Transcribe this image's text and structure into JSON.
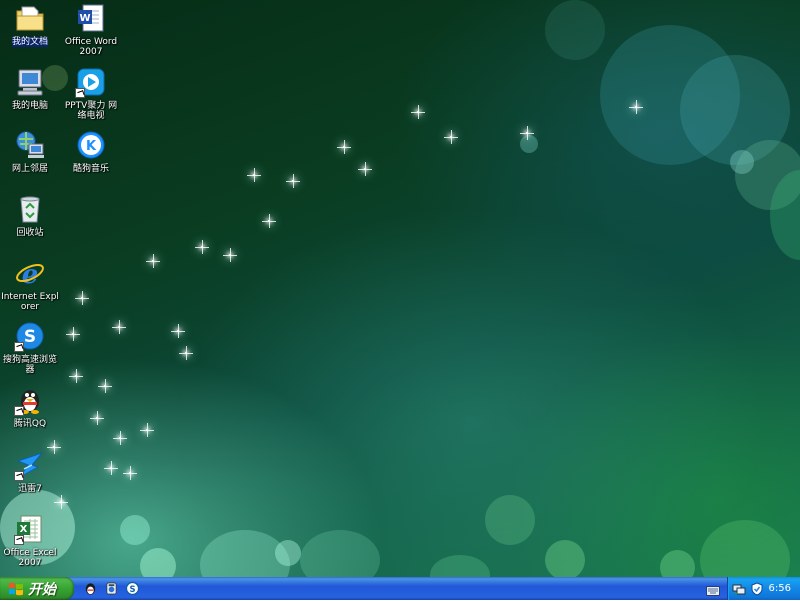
{
  "desktop": {
    "icons": [
      {
        "label": "我的文档",
        "icon": "my-documents-icon",
        "selected": true
      },
      {
        "label": "Office Word 2007",
        "icon": "word-icon"
      },
      {
        "label": "我的电脑",
        "icon": "my-computer-icon"
      },
      {
        "label": "PPTV聚力 网络电视",
        "icon": "pptv-icon"
      },
      {
        "label": "网上邻居",
        "icon": "network-places-icon"
      },
      {
        "label": "酷狗音乐",
        "icon": "kugou-icon"
      },
      {
        "label": "回收站",
        "icon": "recycle-bin-icon"
      },
      {
        "label": "Internet Explorer",
        "icon": "ie-icon"
      },
      {
        "label": "搜狗高速浏览器",
        "icon": "sogou-browser-icon"
      },
      {
        "label": "腾讯QQ",
        "icon": "qq-icon"
      },
      {
        "label": "迅雷7",
        "icon": "xunlei-icon"
      },
      {
        "label": "Office Excel 2007",
        "icon": "excel-icon"
      }
    ]
  },
  "taskbar": {
    "start_label": "开始",
    "quick_launch": [
      "qq-icon",
      "media-player-icon",
      "sogou-browser-icon"
    ],
    "tray_icons": [
      "network-icon",
      "security-shield-icon"
    ],
    "clock": "6:56"
  },
  "colors": {
    "taskbar_blue": "#2663e0",
    "start_green": "#37a532",
    "tray_blue": "#1487e6"
  }
}
